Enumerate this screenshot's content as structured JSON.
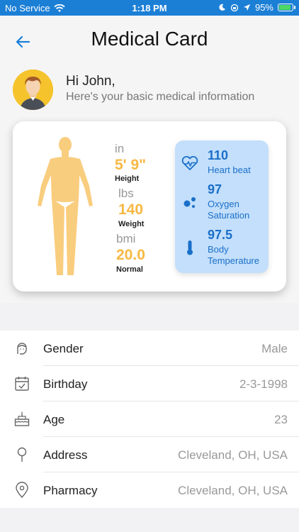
{
  "status": {
    "carrier": "No Service",
    "time": "1:18 PM",
    "battery": "95%",
    "battery_level": 0.95
  },
  "header": {
    "title": "Medical Card",
    "back_icon": "arrow-left-icon"
  },
  "greeting": {
    "name": "Hi John,",
    "subtitle": "Here's your basic medical information"
  },
  "metrics": {
    "height": {
      "unit": "in",
      "value": "5' 9\"",
      "label": "Height"
    },
    "weight": {
      "unit": "lbs",
      "value": "140",
      "label": "Weight"
    },
    "bmi": {
      "unit": "bmi",
      "value": "20.0",
      "label": "Normal"
    }
  },
  "vitals": {
    "heart": {
      "value": "110",
      "label": "Heart beat",
      "icon": "heart-pulse-icon"
    },
    "oxygen": {
      "value": "97",
      "label": "Oxygen Saturation",
      "icon": "oxygen-icon"
    },
    "temperature": {
      "value": "97.5",
      "label": "Body Temperature",
      "icon": "thermometer-icon"
    }
  },
  "details": [
    {
      "label": "Gender",
      "value": "Male",
      "icon": "person-icon"
    },
    {
      "label": "Birthday",
      "value": "2-3-1998",
      "icon": "calendar-icon"
    },
    {
      "label": "Age",
      "value": "23",
      "icon": "cake-icon"
    },
    {
      "label": "Address",
      "value": "Cleveland, OH, USA",
      "icon": "map-pin-icon"
    },
    {
      "label": "Pharmacy",
      "value": "Cleveland, OH, USA",
      "icon": "location-icon"
    }
  ],
  "colors": {
    "accent": "#1c7fd6",
    "metric": "#f7b843",
    "vitals_bg": "#c3dffb",
    "vitals_text": "#1a6fc9"
  }
}
